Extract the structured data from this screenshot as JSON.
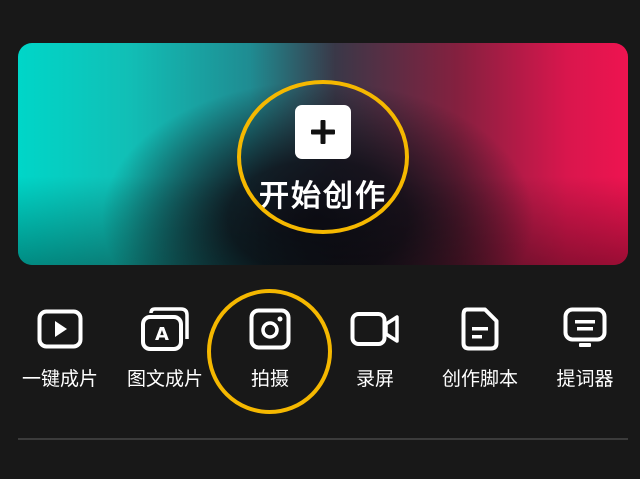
{
  "hero": {
    "label": "开始创作",
    "icon": "plus-icon"
  },
  "tools": [
    {
      "label": "一键成片",
      "icon": "play-icon"
    },
    {
      "label": "图文成片",
      "icon": "image-text-icon"
    },
    {
      "label": "拍摄",
      "icon": "camera-icon"
    },
    {
      "label": "录屏",
      "icon": "screen-record-icon"
    },
    {
      "label": "创作脚本",
      "icon": "script-icon"
    },
    {
      "label": "提词器",
      "icon": "teleprompter-icon"
    }
  ],
  "colors": {
    "background": "#181818",
    "highlight_ring": "#f5b800",
    "gradient_left": "#00d6c8",
    "gradient_right": "#ee1450"
  }
}
